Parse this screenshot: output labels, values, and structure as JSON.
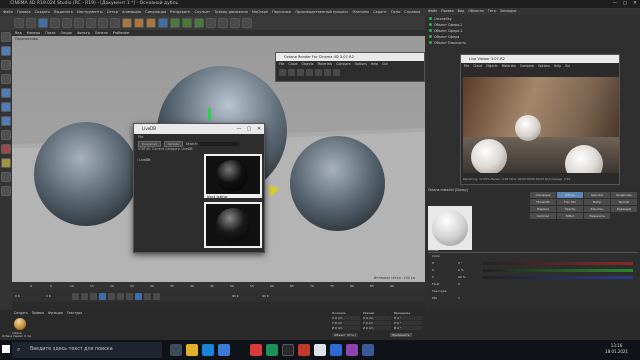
{
  "window": {
    "title": "CINEMA 4D R19.024 Studio (RC - R19) - [Документ 1 *] - Основной дубль",
    "controls": [
      "—",
      "▢",
      "✕"
    ]
  },
  "menubar": [
    "Файл",
    "Правка",
    "Создать",
    "Выделить",
    "Инструменты",
    "Сетки",
    "Анимация",
    "Симуляция",
    "Рендеринг",
    "Скульпт",
    "Трекер движения",
    "MoGraph",
    "Персонаж",
    "Производственный процесс",
    "Плагины",
    "Скрипт",
    "Окно",
    "Справка"
  ],
  "viewport": {
    "menu": [
      "Вид",
      "Камеры",
      "Показ",
      "Опции",
      "Фильтр",
      "Панели",
      "ProRender"
    ],
    "label": "Перспектива",
    "info": "Интервал сетки : 100 см"
  },
  "livedb": {
    "title": "LiveDB",
    "menu": "File",
    "buttons": [
      "Download",
      "Update"
    ],
    "search_label": "Search:",
    "status": "STATUS: Current Category: LiveDB",
    "tree_root": "LiveDB",
    "items": [
      {
        "caption": "black leather"
      },
      {
        "caption": ""
      }
    ],
    "controls": [
      "—",
      "▢",
      "✕"
    ]
  },
  "render_window": {
    "title": "Octane Render For Cinema 4D 3.07-R2",
    "menu": [
      "File",
      "Cloud",
      "Objects",
      "Materials",
      "Compare",
      "Options",
      "Help",
      "Gui"
    ]
  },
  "object_manager": {
    "menu": [
      "Файл",
      "Правка",
      "Вид",
      "Объекты",
      "Теги",
      "Закладки"
    ],
    "objects": [
      "OctaneSky",
      "Объект Сфера.2",
      "Объект Сфера.1",
      "Объект Сфера",
      "Объект Плоскость"
    ]
  },
  "live_viewer": {
    "title": "Live Viewer 3.07-R2",
    "menu": [
      "File",
      "Cloud",
      "Objects",
      "Materials",
      "Compare",
      "Options",
      "Help",
      "Gui"
    ],
    "status": "Rendering: 11.06%  Ms/sec: 0.00  Time: 00:00:00/00:00:04  Spp/maxspp: 2/16"
  },
  "material_manager": {
    "name": "Octane material [Glossy]",
    "tabs": [
      "Основные",
      "Diffuse",
      "Specular",
      "Roughness",
      "Filmwidth",
      "Thin film",
      "Bump",
      "Normal",
      "Displace",
      "Opacity",
      "Transmis.",
      "Редакция",
      "Common",
      "Editor",
      "Назначить"
    ],
    "active_tab": "Diffuse",
    "section": "Diffuse",
    "rows": [
      {
        "label": "Color",
        "value": ""
      },
      {
        "label": "H",
        "value": "0 °"
      },
      {
        "label": "S",
        "value": "0 %"
      },
      {
        "label": "V",
        "value": "60 %"
      },
      {
        "label": "Float",
        "value": "0"
      },
      {
        "label": "Текстура",
        "value": ""
      },
      {
        "label": "Mix",
        "value": "1"
      }
    ]
  },
  "timeline": {
    "start": "0 K",
    "end": "90 K",
    "ticks": [
      "0",
      "5",
      "10",
      "15",
      "20",
      "25",
      "30",
      "35",
      "40",
      "45",
      "50",
      "55",
      "60",
      "65",
      "70",
      "75",
      "80",
      "85",
      "90"
    ],
    "frame_left": "0 K",
    "frame_right": "90 K"
  },
  "material_tray": {
    "menu": [
      "Создать",
      "Правка",
      "Функция",
      "Текстура"
    ],
    "thumb_label": "octane"
  },
  "coords": {
    "headers": [
      "Позиция",
      "Размер",
      "Вращение"
    ],
    "rows": [
      [
        "X 0 cm",
        "X 0 cm",
        "H 0 °"
      ],
      [
        "Y 0 cm",
        "Y 0 cm",
        "P 0 °"
      ],
      [
        "Z 0 cm",
        "Z 0 cm",
        "B 0 °"
      ]
    ],
    "mode": "Объект (Отн.)",
    "apply": "Применить"
  },
  "statusbar": "Octane Viewer: 0 ms",
  "taskbar": {
    "search_placeholder": "Введите здесь текст для поиска",
    "time": "13:16",
    "date": "18.01.2021"
  },
  "colors": {
    "accent": "#3f6fa8",
    "c4d_green": "#2bb34a",
    "titlebar": "#1e1e1e"
  }
}
